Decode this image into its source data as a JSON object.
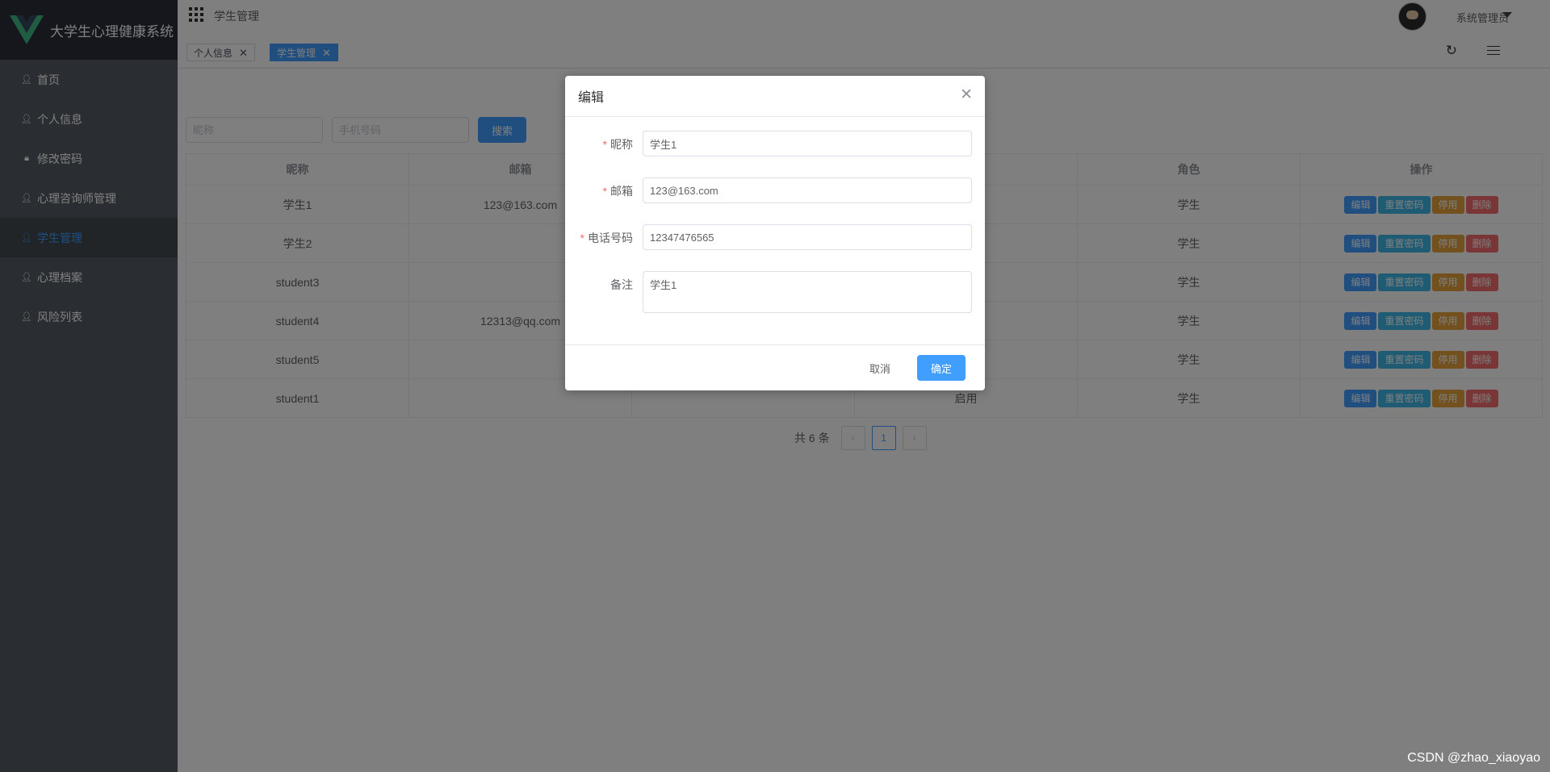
{
  "app": {
    "title": "大学生心理健康系统"
  },
  "sidebar": {
    "items": [
      {
        "label": "首页",
        "icon": "person-icon"
      },
      {
        "label": "个人信息",
        "icon": "person-icon"
      },
      {
        "label": "修改密码",
        "icon": "lock-icon"
      },
      {
        "label": "心理咨询师管理",
        "icon": "person-icon"
      },
      {
        "label": "学生管理",
        "icon": "person-icon",
        "active": true
      },
      {
        "label": "心理档案",
        "icon": "person-icon"
      },
      {
        "label": "风险列表",
        "icon": "person-icon"
      }
    ]
  },
  "header": {
    "breadcrumb": "学生管理",
    "user": "系统管理员"
  },
  "tags": [
    {
      "label": "个人信息",
      "active": false
    },
    {
      "label": "学生管理",
      "active": true
    }
  ],
  "search": {
    "nickname_placeholder": "昵称",
    "phone_placeholder": "手机号码",
    "button": "搜索"
  },
  "table": {
    "columns": [
      "昵称",
      "邮箱",
      "",
      "",
      "角色",
      "操作"
    ],
    "rows": [
      {
        "name": "学生1",
        "email": "123@163.com",
        "status": "",
        "role": "学生"
      },
      {
        "name": "学生2",
        "email": "",
        "status": "",
        "role": "学生"
      },
      {
        "name": "student3",
        "email": "",
        "status": "",
        "role": "学生"
      },
      {
        "name": "student4",
        "email": "12313@qq.com",
        "status": "",
        "role": "学生"
      },
      {
        "name": "student5",
        "email": "",
        "status": "",
        "role": "学生"
      },
      {
        "name": "student1",
        "email": "",
        "status": "启用",
        "role": "学生"
      }
    ],
    "actions": {
      "edit": "编辑",
      "reset": "重置密码",
      "disable": "停用",
      "delete": "删除"
    }
  },
  "pagination": {
    "total_text": "共 6 条",
    "current_page": "1"
  },
  "dialog": {
    "title": "编辑",
    "fields": {
      "nickname": {
        "label": "昵称",
        "value": "学生1",
        "required": true
      },
      "email": {
        "label": "邮箱",
        "value": "123@163.com",
        "required": true
      },
      "phone": {
        "label": "电话号码",
        "value": "12347476565",
        "required": true
      },
      "remark": {
        "label": "备注",
        "value": "学生1",
        "required": false
      }
    },
    "cancel": "取消",
    "confirm": "确定"
  },
  "watermark": "CSDN @zhao_xiaoyao",
  "colors": {
    "primary": "#409eff",
    "sidebar_bg": "#545c64",
    "danger": "#f56c6c",
    "warning": "#e6a23c",
    "success": "#67c23a"
  }
}
